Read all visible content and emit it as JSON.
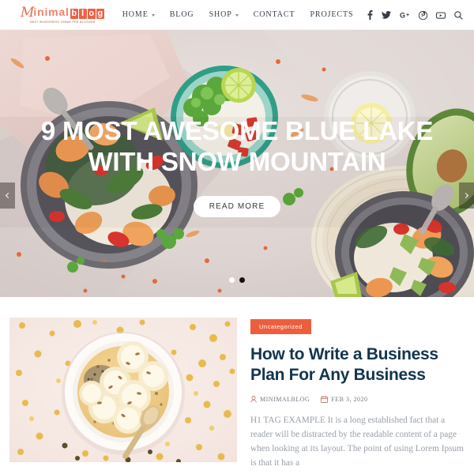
{
  "header": {
    "logo": {
      "script_letter": "M",
      "mid_text": "inimal",
      "boxed_letters": [
        "b",
        "l",
        "o",
        "g"
      ],
      "full_name": "Minimalblog",
      "tagline": "Best WordPress Theme for Blogger"
    },
    "nav": [
      {
        "label": "HOME",
        "has_dropdown": true
      },
      {
        "label": "BLOG",
        "has_dropdown": false
      },
      {
        "label": "SHOP",
        "has_dropdown": true
      },
      {
        "label": "CONTACT",
        "has_dropdown": false
      },
      {
        "label": "PROJECTS",
        "has_dropdown": false
      }
    ],
    "social": [
      {
        "name": "facebook-icon",
        "glyph": "f"
      },
      {
        "name": "twitter-icon",
        "glyph": "t"
      },
      {
        "name": "google-plus-icon",
        "glyph": "G+"
      },
      {
        "name": "pinterest-icon",
        "glyph": "p"
      },
      {
        "name": "youtube-icon",
        "glyph": "yt"
      },
      {
        "name": "search-icon",
        "glyph": "q"
      }
    ]
  },
  "hero": {
    "title": "9 MOST AWESOME BLUE LAKE WITH SNOW MOUNTAIN",
    "button_label": "READ MORE",
    "prev_label": "Previous slide",
    "next_label": "Next slide",
    "slides": [
      {
        "active": false
      },
      {
        "active": true
      }
    ],
    "current_slide": 2,
    "total_slides": 2
  },
  "post": {
    "category": "Uncategorized",
    "title": "How to Write a Business Plan For Any Business",
    "author": "MINIMALBLOG",
    "date": "FEB 3, 2020",
    "excerpt": "H1 TAG EXAMPLE It is a long established fact that a reader will be distracted by the readable content of a page when looking at its layout. The point of using Lorem Ipsum is that it has a"
  },
  "colors": {
    "brand_orange": "#ee5e3c",
    "logo_coral": "#f4816a",
    "title_navy": "#11354d",
    "body_gray": "#99a0a8",
    "nav_text": "#3d3d4e"
  }
}
